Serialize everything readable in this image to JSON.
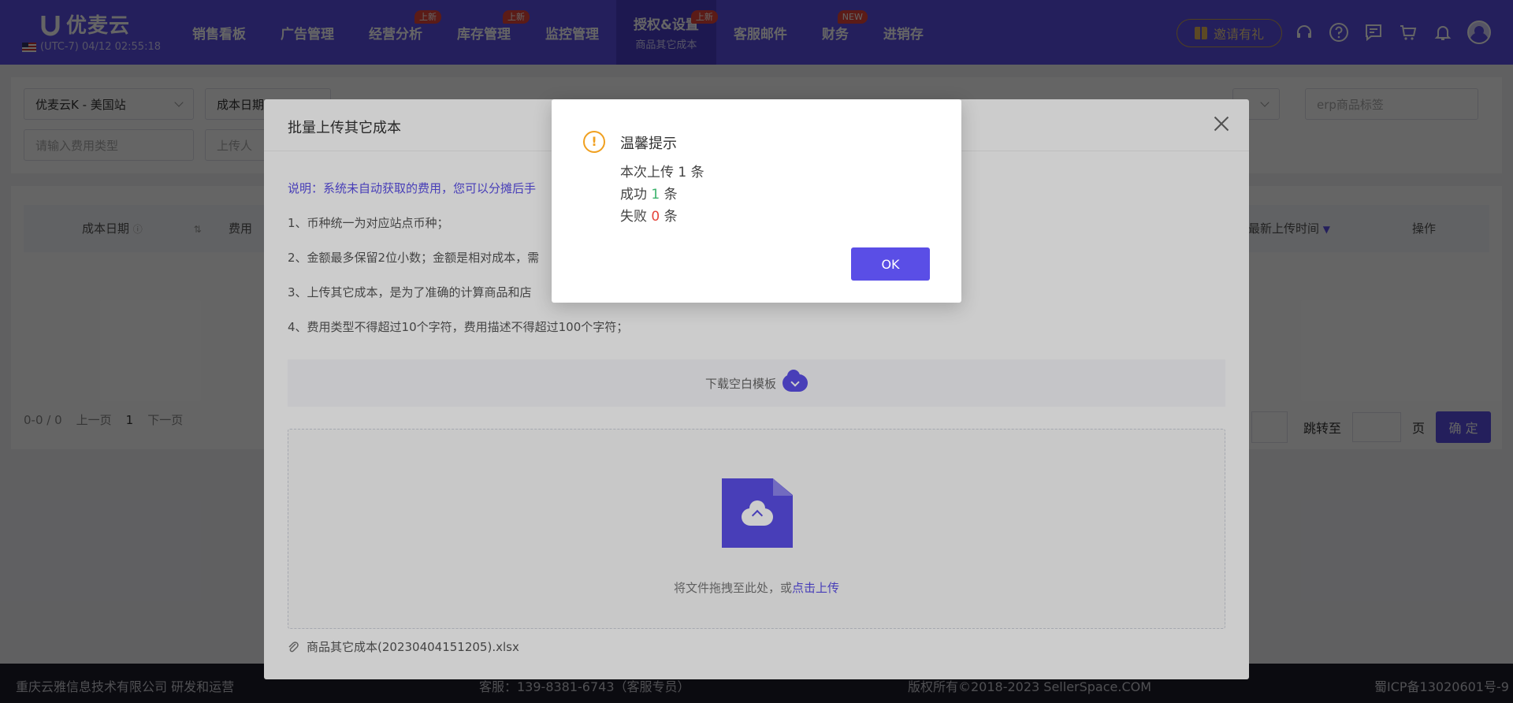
{
  "app": {
    "name": "优麦云",
    "clock": "(UTC-7) 04/12 02:55:18"
  },
  "nav": [
    {
      "label": "销售看板",
      "badge": ""
    },
    {
      "label": "广告管理",
      "badge": ""
    },
    {
      "label": "经营分析",
      "badge": "上新"
    },
    {
      "label": "库存管理",
      "badge": "上新"
    },
    {
      "label": "监控管理",
      "badge": ""
    },
    {
      "label": "授权&设置",
      "badge": "上新",
      "sub": "商品其它成本",
      "active": true
    },
    {
      "label": "客服邮件",
      "badge": ""
    },
    {
      "label": "财务",
      "badge": "NEW"
    },
    {
      "label": "进销存",
      "badge": ""
    }
  ],
  "header": {
    "invite_label": "邀请有礼"
  },
  "filters": {
    "shop": "优麦云K - 美国站",
    "date_type": "成本日期",
    "erp_placeholder": "erp商品标签",
    "fee_type_placeholder": "请输入费用类型",
    "uploader_placeholder": "上传人"
  },
  "table": {
    "headers": [
      "成本日期",
      "费用",
      "最新上传时间",
      "操作"
    ]
  },
  "pager": {
    "range": "0-0 / 0",
    "prev": "上一页",
    "page": "1",
    "next": "下一页",
    "jump_label": "跳转至",
    "page_unit": "页",
    "confirm": "确 定"
  },
  "footer": {
    "company": "重庆云雅信息技术有限公司 研发和运营",
    "service": "客服：139-8381-6743（客服专员）",
    "copyright": "版权所有©2018-2023 SellerSpace.COM",
    "icp": "蜀ICP备13020601号-9"
  },
  "upload_modal": {
    "title": "批量上传其它成本",
    "note": "说明：系统未自动获取的费用，您可以分摊后手",
    "rules": [
      "1、币种统一为对应站点币种；",
      "2、金额最多保留2位小数；金额是相对成本，需",
      "3、上传其它成本，是为了准确的计算商品和店",
      "4、费用类型不得超过10个字符，费用描述不得超过100个字符；"
    ],
    "download_label": "下载空白模板",
    "drop_text": "将文件拖拽至此处，或",
    "drop_link": "点击上传",
    "file_name": "商品其它成本(20230404151205).xlsx"
  },
  "alert": {
    "title": "温馨提示",
    "line1": "本次上传 1 条",
    "success_label": "成功",
    "success_count": "1",
    "fail_label": "失败",
    "fail_count": "0",
    "unit": "条",
    "ok_label": "OK"
  },
  "colors": {
    "brand": "#5a4ee6",
    "warning": "#f0a020",
    "success": "#3bb26b",
    "danger": "#e5453b"
  }
}
